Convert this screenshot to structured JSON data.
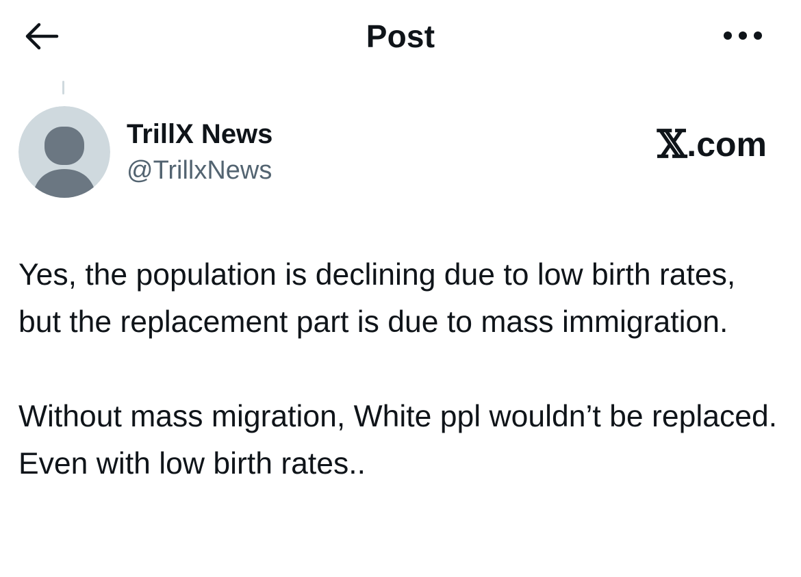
{
  "header": {
    "title": "Post",
    "back_icon": "arrow-left-icon",
    "more_icon": "more-horizontal-icon"
  },
  "author": {
    "name": "TrillX News",
    "handle": "@TrillxNews",
    "avatar": "default-avatar-silhouette"
  },
  "watermark": {
    "symbol": "𝕏",
    "text": ".com"
  },
  "post": {
    "text": "Yes, the population is declining due to low birth rates, but the replacement part is due to mass immigration.\n\nWithout mass migration, White ppl wouldn’t be replaced. Even with low birth rates.."
  },
  "colors": {
    "text_primary": "#0f1419",
    "text_secondary": "#536471",
    "avatar_bg": "#cfd9de",
    "avatar_figure": "#6b7782",
    "background": "#ffffff"
  }
}
